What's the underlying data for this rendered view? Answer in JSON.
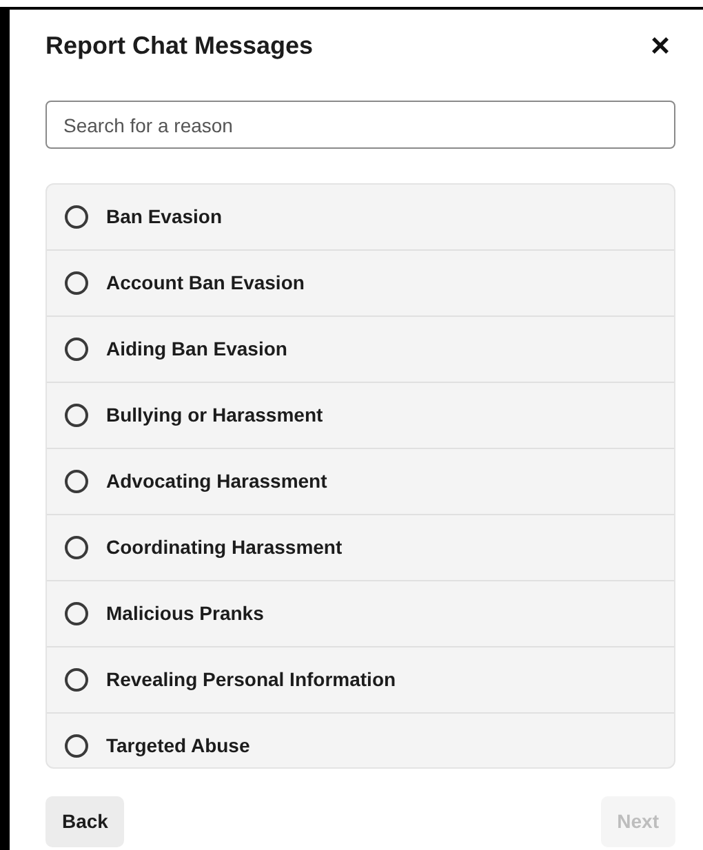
{
  "dialog": {
    "title": "Report Chat Messages",
    "close": "×"
  },
  "search": {
    "placeholder": "Search for a reason"
  },
  "reasons": [
    {
      "label": "Ban Evasion",
      "selected": false,
      "hovered": false
    },
    {
      "label": "Account Ban Evasion",
      "selected": false,
      "hovered": false
    },
    {
      "label": "Aiding Ban Evasion",
      "selected": false,
      "hovered": false
    },
    {
      "label": "Bullying or Harassment",
      "selected": false,
      "hovered": false
    },
    {
      "label": "Advocating Harassment",
      "selected": false,
      "hovered": false
    },
    {
      "label": "Coordinating Harassment",
      "selected": false,
      "hovered": false
    },
    {
      "label": "Malicious Pranks",
      "selected": false,
      "hovered": false
    },
    {
      "label": "Revealing Personal Information",
      "selected": false,
      "hovered": false
    },
    {
      "label": "Targeted Abuse",
      "selected": false,
      "hovered": false
    }
  ],
  "buttons": [
    {
      "label": "Back",
      "disabled": false
    },
    {
      "label": "Next",
      "disabled": true
    }
  ]
}
